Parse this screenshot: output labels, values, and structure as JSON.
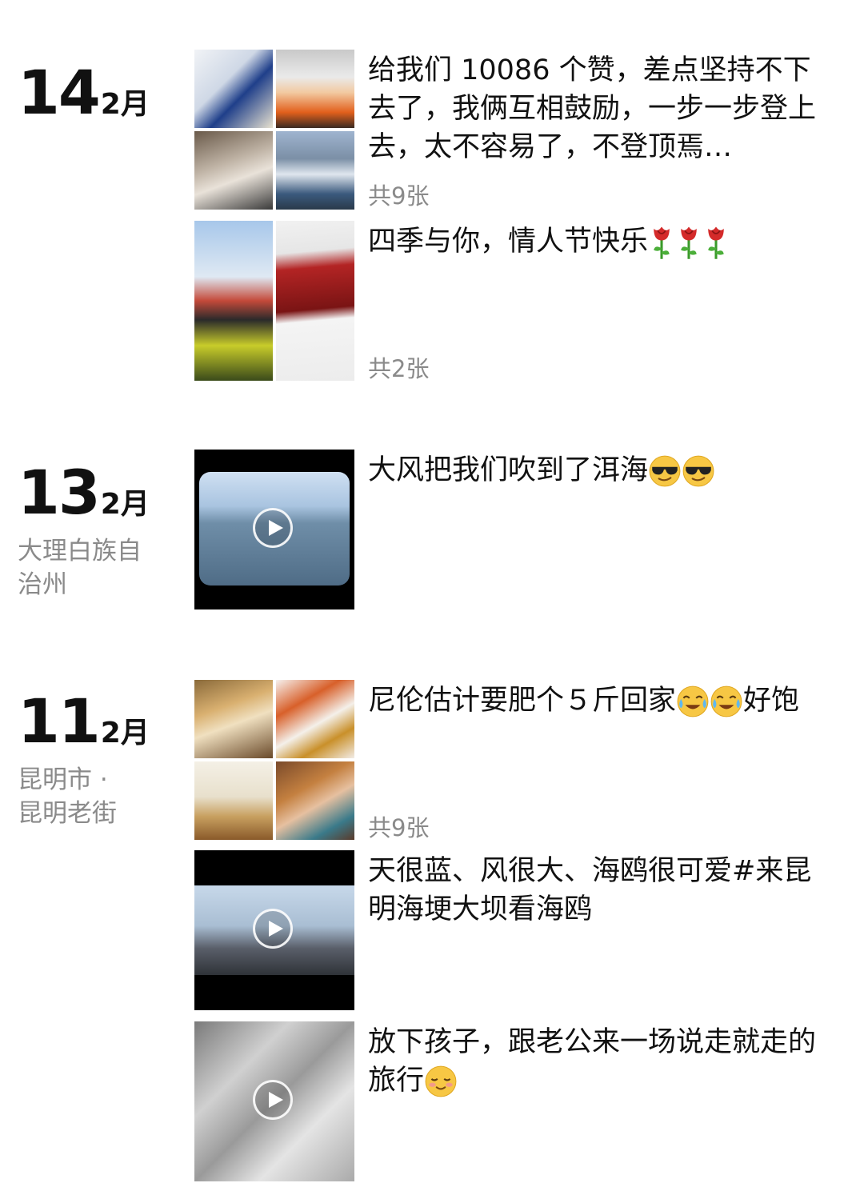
{
  "groups": [
    {
      "day": "14",
      "month": "2月",
      "location": [],
      "posts": [
        {
          "type": "photos",
          "caption": "给我们 10086 个赞，差点坚持不下去了，我俩互相鼓励，一步一步登上去，太不容易了，不登顶焉…",
          "count": "共9张"
        },
        {
          "type": "photos",
          "caption": "四季与你，情人节快乐",
          "caption_emoji": [
            "rose-icon",
            "rose-icon",
            "rose-icon"
          ],
          "count": "共2张"
        }
      ]
    },
    {
      "day": "13",
      "month": "2月",
      "location": [
        "大理白族自",
        "治州"
      ],
      "posts": [
        {
          "type": "video",
          "caption": "大风把我们吹到了洱海",
          "caption_emoji": [
            "cool-sunglasses-icon",
            "cool-sunglasses-icon"
          ]
        }
      ]
    },
    {
      "day": "11",
      "month": "2月",
      "location": [
        "昆明市 ·",
        "昆明老街"
      ],
      "posts": [
        {
          "type": "photos",
          "caption": "尼伦估计要肥个５斤回家",
          "caption_emoji": [
            "crying-laughing-icon",
            "crying-laughing-icon"
          ],
          "caption_suffix": "好饱",
          "count": "共9张"
        },
        {
          "type": "video",
          "caption": "天很蓝、风很大、海鸥很可爱#来昆明海埂大坝看海鸥"
        },
        {
          "type": "video",
          "caption": "放下孩子，跟老公来一场说走就走的旅行",
          "caption_emoji": [
            "smiling-closed-eyes-icon"
          ]
        }
      ]
    }
  ]
}
